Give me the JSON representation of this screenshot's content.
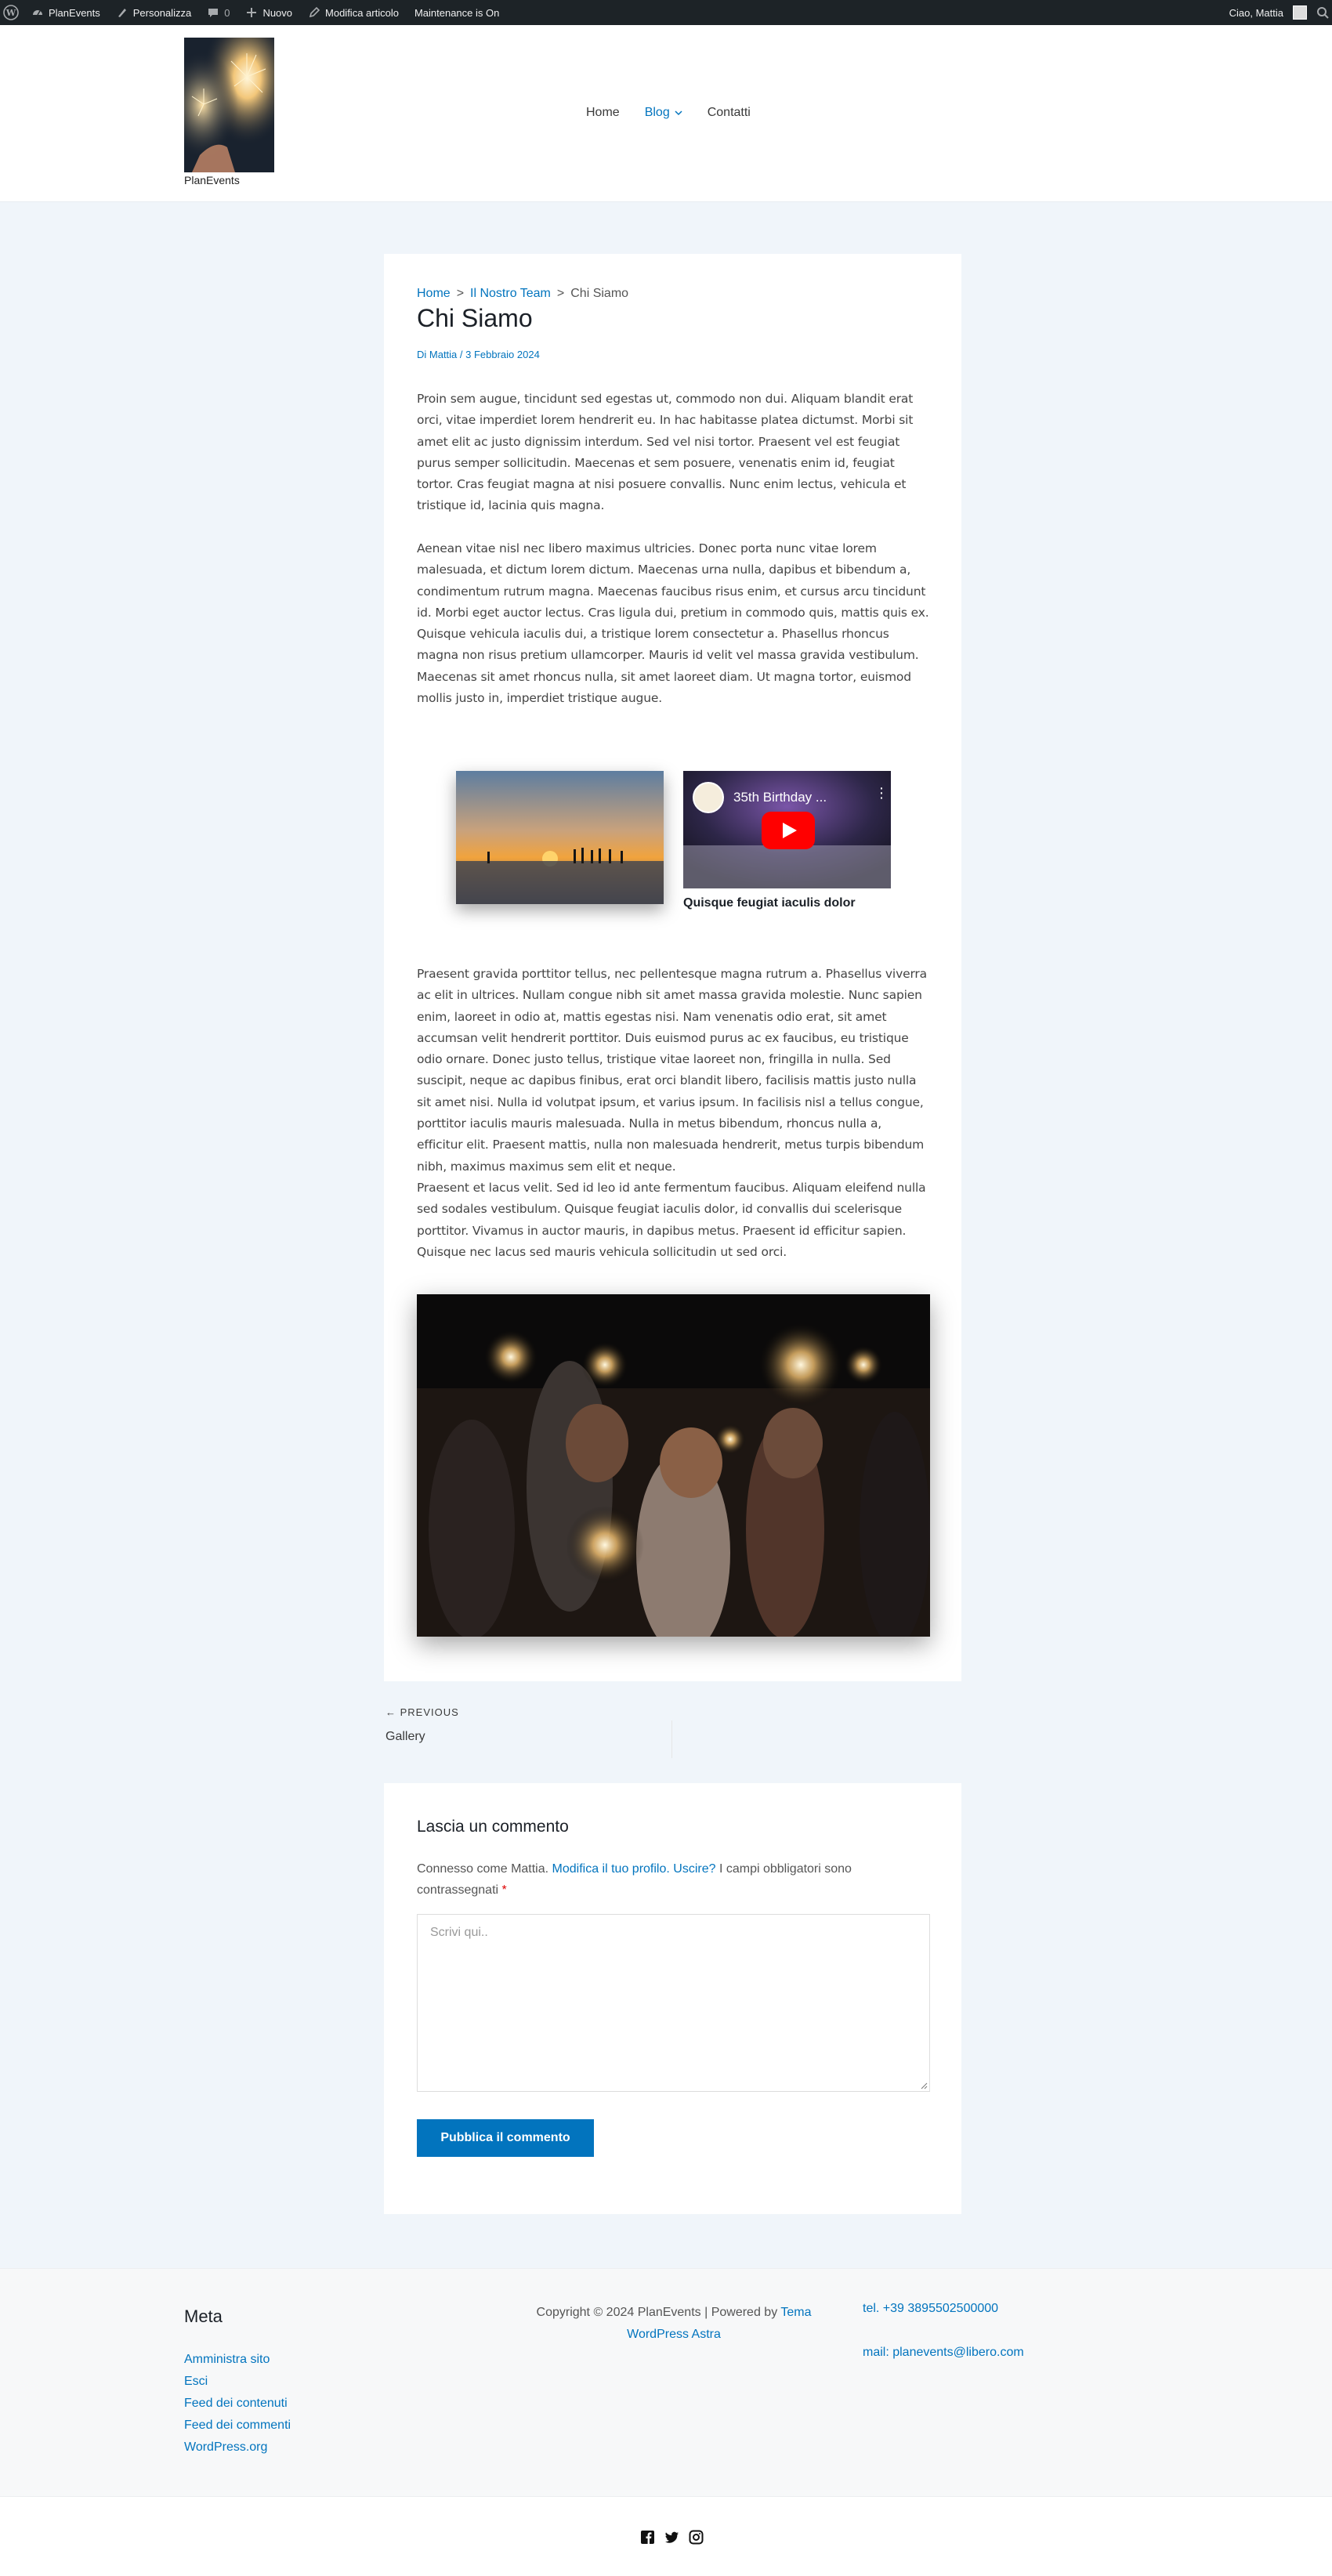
{
  "admin_bar": {
    "site_name": "PlanEvents",
    "customize": "Personalizza",
    "comments_count": "0",
    "new": "Nuovo",
    "edit_post": "Modifica articolo",
    "maintenance": "Maintenance is On",
    "greeting": "Ciao, Mattia"
  },
  "header": {
    "site_title": "PlanEvents",
    "nav": [
      {
        "label": "Home"
      },
      {
        "label": "Blog"
      },
      {
        "label": "Contatti"
      }
    ]
  },
  "breadcrumb": {
    "home": "Home",
    "separator": ">",
    "team": "Il Nostro Team",
    "current": "Chi Siamo"
  },
  "post": {
    "title": "Chi Siamo",
    "meta": "Di Mattia / 3 Febbraio 2024",
    "paragraphs": [
      "Proin sem augue, tincidunt sed egestas ut, commodo non dui. Aliquam blandit erat orci, vitae imperdiet lorem hendrerit eu. In hac habitasse platea dictumst. Morbi sit amet elit ac justo dignissim interdum. Sed vel nisi tortor. Praesent vel est feugiat purus semper sollicitudin. Maecenas et sem posuere, venenatis enim id, feugiat tortor. Cras feugiat magna at nisi posuere convallis. Nunc enim lectus, vehicula et tristique id, lacinia quis magna.",
      "Aenean vitae nisl nec libero maximus ultricies. Donec porta nunc vitae lorem malesuada, et dictum lorem dictum. Maecenas urna nulla, dapibus et bibendum a, condimentum rutrum magna. Maecenas faucibus risus enim, et cursus arcu tincidunt id. Morbi eget auctor lectus. Cras ligula dui, pretium in commodo quis, mattis quis ex. Quisque vehicula iaculis dui, a tristique lorem consectetur a. Phasellus rhoncus magna non risus pretium ullamcorper. Mauris id velit vel massa gravida vestibulum. Maecenas sit amet rhoncus nulla, sit amet laoreet diam. Ut magna tortor, euismod mollis justo in, imperdiet tristique augue.",
      "Praesent gravida porttitor tellus, nec pellentesque magna rutrum a. Phasellus viverra ac elit in ultrices. Nullam congue nibh sit amet massa gravida molestie. Nunc sapien enim, laoreet in odio at, mattis egestas nisi. Nam venenatis odio erat, sit amet accumsan velit hendrerit porttitor. Duis euismod purus ac ex faucibus, eu tristique odio ornare. Donec justo tellus, tristique vitae laoreet non, fringilla in nulla. Sed suscipit, neque ac dapibus finibus, erat orci blandit libero, facilisis mattis justo nulla sit amet nisi. Nulla id volutpat ipsum, et varius ipsum. In facilisis nisl a tellus congue, porttitor iaculis mauris malesuada. Nulla in metus bibendum, rhoncus nulla a, efficitur elit. Praesent mattis, nulla non malesuada hendrerit, metus turpis bibendum nibh, maximus maximus sem elit et neque.",
      "Praesent et lacus velit. Sed id leo id ante fermentum faucibus. Aliquam eleifend nulla sed sodales vestibulum. Quisque feugiat iaculis dolor, id convallis dui scelerisque porttitor. Vivamus in auctor mauris, in dapibus metus. Praesent id efficitur sapien. Quisque nec lacus sed mauris vehicula sollicitudin ut sed orci."
    ],
    "video_title": "35th Birthday ...",
    "caption": "Quisque feugiat iaculis dolor"
  },
  "post_nav": {
    "kicker": "← PREVIOUS",
    "title": "Gallery"
  },
  "comments": {
    "title": "Lascia un commento",
    "logged_prefix": "Connesso come Mattia.",
    "edit_profile": "Modifica il tuo profilo.",
    "logout": "Uscire?",
    "required_text": "I campi obbligatori sono contrassegnati",
    "required_mark": "*",
    "placeholder": "Scrivi qui..",
    "submit": "Pubblica il commento"
  },
  "footer": {
    "meta_title": "Meta",
    "meta_links": [
      "Amministra sito",
      "Esci",
      "Feed dei contenuti",
      "Feed dei commenti",
      "WordPress.org"
    ],
    "copyright": "Copyright © 2024 PlanEvents | Powered by",
    "theme_link": "Tema WordPress Astra",
    "phone": "tel. +39 3895502500000",
    "email": "mail: planevents@libero.com"
  },
  "colors": {
    "accent": "#0274be",
    "admin_bar": "#1d2327",
    "page_bg": "#f0f5fa"
  }
}
